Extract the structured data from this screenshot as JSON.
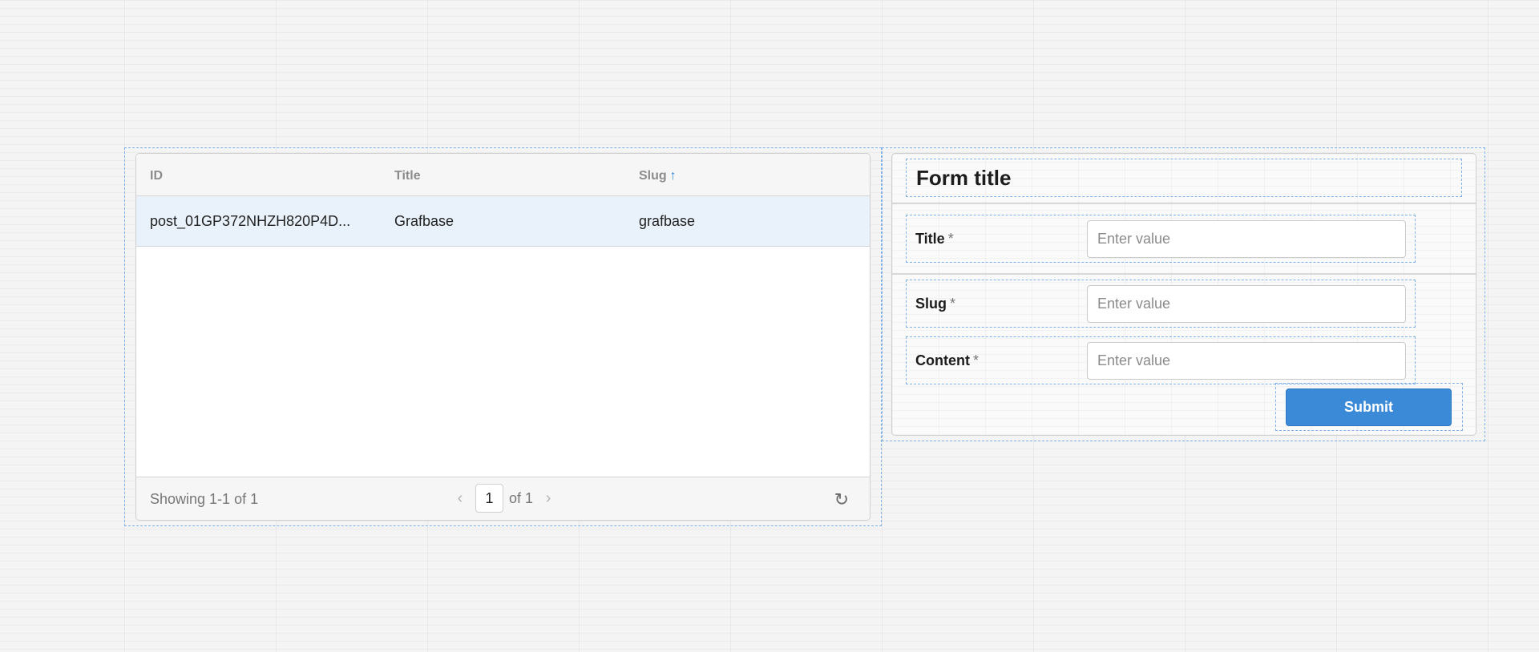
{
  "table": {
    "columns": [
      {
        "label": "ID"
      },
      {
        "label": "Title"
      },
      {
        "label": "Slug",
        "sort": "ascending"
      }
    ],
    "rows": [
      {
        "id": "post_01GP372NHZH820P4D...",
        "title": "Grafbase",
        "slug": "grafbase"
      }
    ],
    "footer": {
      "showing": "Showing 1-1 of 1",
      "page": "1",
      "of_pages": "of 1",
      "prev_icon": "chevron-left-icon",
      "next_icon": "chevron-right-icon",
      "refresh_icon": "refresh-icon"
    }
  },
  "form": {
    "title": "Form title",
    "fields": [
      {
        "label": "Title",
        "required_mark": "*",
        "placeholder": "Enter value",
        "value": ""
      },
      {
        "label": "Slug",
        "required_mark": "*",
        "placeholder": "Enter value",
        "value": ""
      },
      {
        "label": "Content",
        "required_mark": "*",
        "placeholder": "Enter value",
        "value": ""
      }
    ],
    "submit_label": "Submit"
  },
  "colors": {
    "accent": "#3a8ad8",
    "selected_row": "#e9f2fb",
    "selection_outline": "#7fb0e8"
  }
}
